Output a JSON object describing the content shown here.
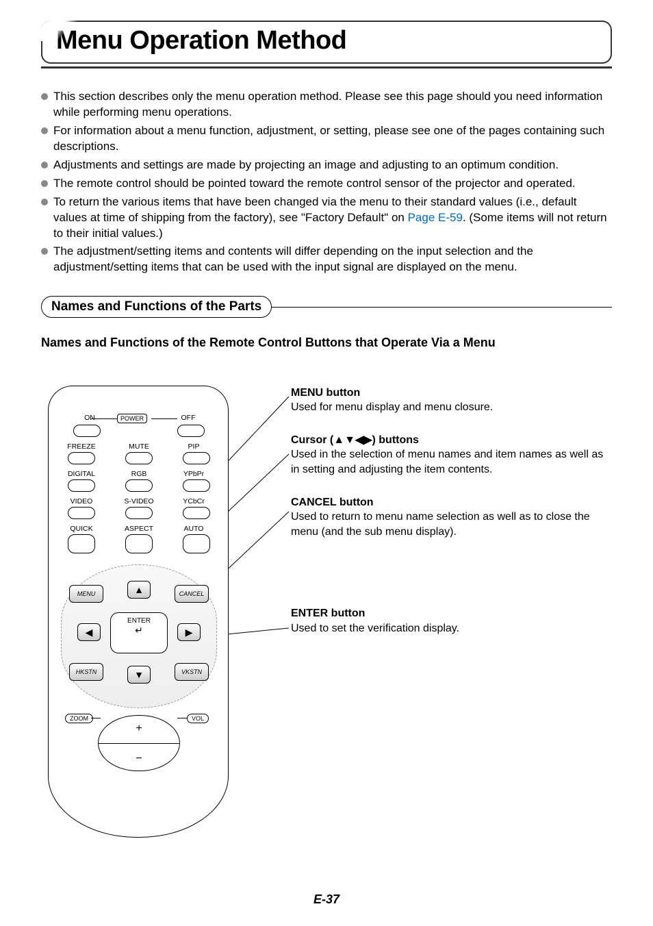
{
  "title": "Menu Operation Method",
  "bullets": [
    "This section describes only the menu operation method. Please see this page should you need information while performing menu operations.",
    "For information about a menu function, adjustment, or setting, please see one of the pages containing such descriptions.",
    "Adjustments and settings are made by projecting an image and adjusting to an optimum condition.",
    "The remote control should be pointed toward the remote control sensor of the projector and operated.",
    {
      "pre": "To return the various items that have been changed via the menu to their standard values (i.e., default values at time of shipping from the factory), see \"Factory Default\" on ",
      "link": "Page E-59",
      "post": ". (Some items will not return to their initial values.)"
    },
    "The adjustment/setting items and contents will differ depending on the input selection and the adjustment/setting items that can be used with the input signal are displayed on the menu."
  ],
  "section_header": "Names and Functions of the Parts",
  "sub_heading": "Names and Functions of the Remote Control Buttons that Operate Via a Menu",
  "callouts": {
    "menu": {
      "title": "MENU button",
      "desc": "Used for menu display and menu closure."
    },
    "cursor": {
      "title": "Cursor (▲▼◀▶) buttons",
      "desc": "Used in the selection of menu names and item names as well as in setting and adjusting the item contents."
    },
    "cancel": {
      "title": "CANCEL button",
      "desc": "Used to return to menu name selection as well as to close the menu (and the sub menu display)."
    },
    "enter": {
      "title": "ENTER button",
      "desc": "Used to set the verification display."
    }
  },
  "remote": {
    "top_row": {
      "on": "ON",
      "power": "POWER",
      "off": "OFF"
    },
    "row2": {
      "freeze": "FREEZE",
      "mute": "MUTE",
      "pip": "PIP"
    },
    "row3": {
      "digital": "DIGITAL",
      "rgb": "RGB",
      "ypbpr": "YPbPr"
    },
    "row4": {
      "video": "VIDEO",
      "svideo": "S-VIDEO",
      "ycbcr": "YCbCr"
    },
    "row5": {
      "quick": "QUICK",
      "aspect": "ASPECT",
      "auto": "AUTO"
    },
    "nav": {
      "menu": "MENU",
      "cancel": "CANCEL",
      "enter": "ENTER",
      "hkstn": "HKSTN",
      "vkstn": "VKSTN",
      "up": "▲",
      "down": "▼",
      "left": "◀",
      "right": "▶",
      "enter_arrow": "↵"
    },
    "zoom": "ZOOM",
    "vol": "VOL",
    "plus": "+",
    "minus": "−"
  },
  "page_number": "E-37"
}
